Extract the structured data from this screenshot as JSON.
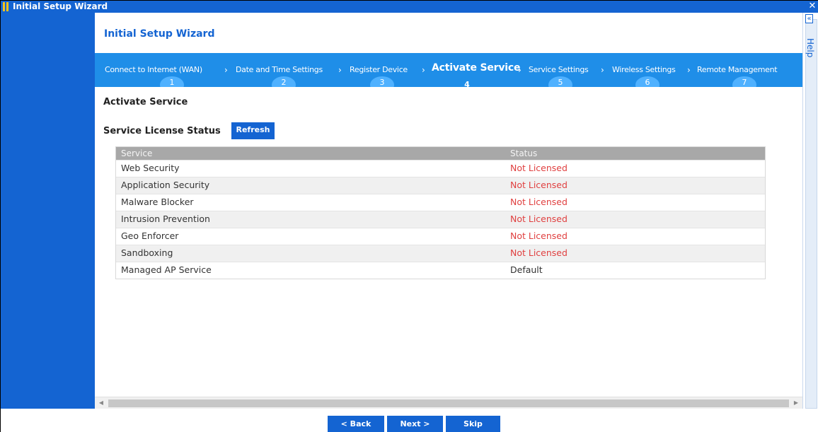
{
  "window": {
    "title": "Initial Setup Wizard",
    "close_glyph": "✕"
  },
  "help": {
    "collapse_glyph": "«",
    "label": "Help"
  },
  "wizard": {
    "title": "Initial Setup Wizard"
  },
  "steps": [
    {
      "label": "Connect to Internet (WAN)",
      "num": "1"
    },
    {
      "label": "Date and Time Settings",
      "num": "2"
    },
    {
      "label": "Register Device",
      "num": "3"
    },
    {
      "label": "Activate Service",
      "num": "4"
    },
    {
      "label": "Service Settings",
      "num": "5"
    },
    {
      "label": "Wireless Settings",
      "num": "6"
    },
    {
      "label": "Remote Management",
      "num": "7"
    }
  ],
  "chevron": "›",
  "page": {
    "section_title": "Activate Service",
    "status_title": "Service License Status",
    "refresh_label": "Refresh"
  },
  "table": {
    "headers": {
      "service": "Service",
      "status": "Status"
    },
    "rows": [
      {
        "service": "Web Security",
        "status": "Not Licensed"
      },
      {
        "service": "Application Security",
        "status": "Not Licensed"
      },
      {
        "service": "Malware Blocker",
        "status": "Not Licensed"
      },
      {
        "service": "Intrusion Prevention",
        "status": "Not Licensed"
      },
      {
        "service": "Geo Enforcer",
        "status": "Not Licensed"
      },
      {
        "service": "Sandboxing",
        "status": "Not Licensed"
      },
      {
        "service": "Managed AP Service",
        "status": "Default"
      }
    ]
  },
  "scroll": {
    "left_glyph": "◀",
    "right_glyph": "▶"
  },
  "footer": {
    "back_label": "< Back",
    "next_label": "Next >",
    "skip_label": "Skip"
  },
  "colors": {
    "brand_blue": "#1464d2",
    "step_bar": "#1f8ee8",
    "step_num": "#4fb1ff",
    "not_licensed": "#e04040"
  }
}
